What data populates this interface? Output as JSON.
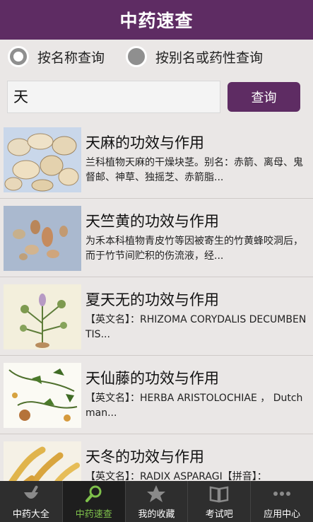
{
  "header": {
    "title": "中药速查"
  },
  "search": {
    "mode_options": [
      {
        "label": "按名称查询",
        "selected": true
      },
      {
        "label": "按别名或药性查询",
        "selected": false
      }
    ],
    "query": "天",
    "button_label": "查询"
  },
  "results": [
    {
      "title": "天麻的功效与作用",
      "description": "兰科植物天麻的干燥块茎。别名：赤箭、离母、鬼督邮、神草、独摇芝、赤箭脂...",
      "image": "tianma-root"
    },
    {
      "title": "天竺黄的功效与作用",
      "description": "为禾本科植物青皮竹等因被寄生的竹黄蜂咬洞后，而于竹节间贮积的伤流液，经...",
      "image": "tianzhuhuang-pieces"
    },
    {
      "title": "夏天无的功效与作用",
      "description": "【英文名】：RHIZOMA CORYDALIS DECUMBENTIS...",
      "image": "xiatianwu-plant"
    },
    {
      "title": "天仙藤的功效与作用",
      "description": "【英文名】：HERBA ARISTOLOCHIAE ， Dutchman...",
      "image": "tianxianteng-plant"
    },
    {
      "title": "天冬的功效与作用",
      "description": "【英文名】：RADIX ASPARAGI【拼音】：",
      "image": "tiandong-roots"
    }
  ],
  "tabbar": {
    "items": [
      {
        "label": "中药大全",
        "icon": "mortar-icon",
        "active": false
      },
      {
        "label": "中药速查",
        "icon": "search-icon",
        "active": true
      },
      {
        "label": "我的收藏",
        "icon": "star-icon",
        "active": false
      },
      {
        "label": "考试吧",
        "icon": "book-icon",
        "active": false
      },
      {
        "label": "应用中心",
        "icon": "more-dots-icon",
        "active": false
      }
    ]
  },
  "colors": {
    "brand": "#5e2c63",
    "panel": "#eae7e6",
    "active_tab": "#7ec04b",
    "tabbar": "#2e2e2e"
  }
}
